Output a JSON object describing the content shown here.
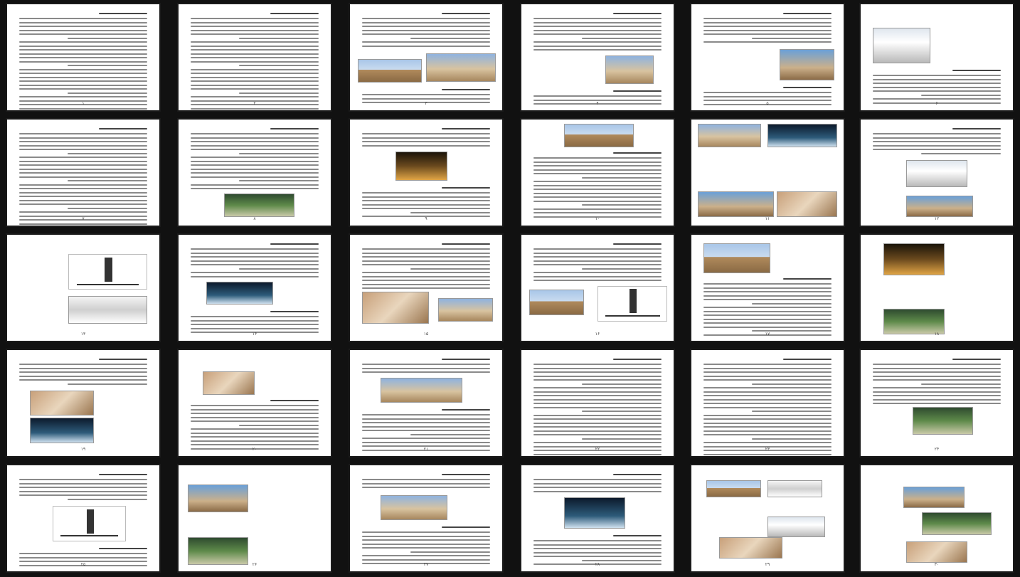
{
  "pages": [
    {
      "n": "۱"
    },
    {
      "n": "۲"
    },
    {
      "n": "۳"
    },
    {
      "n": "۴"
    },
    {
      "n": "۵"
    },
    {
      "n": "۶"
    },
    {
      "n": "۷"
    },
    {
      "n": "۸"
    },
    {
      "n": "۹"
    },
    {
      "n": "۱۰"
    },
    {
      "n": "۱۱"
    },
    {
      "n": "۱۲"
    },
    {
      "n": "۱۳"
    },
    {
      "n": "۱۴"
    },
    {
      "n": "۱۵"
    },
    {
      "n": "۱۶"
    },
    {
      "n": "۱۷"
    },
    {
      "n": "۱۸"
    },
    {
      "n": "۱۹"
    },
    {
      "n": "۲۰"
    },
    {
      "n": "۲۱"
    },
    {
      "n": "۲۲"
    },
    {
      "n": "۲۳"
    },
    {
      "n": "۲۴"
    },
    {
      "n": "۲۵"
    },
    {
      "n": "۲۶"
    },
    {
      "n": "۲۷"
    },
    {
      "n": "۲۸"
    },
    {
      "n": "۲۹"
    },
    {
      "n": "۳۰"
    }
  ]
}
